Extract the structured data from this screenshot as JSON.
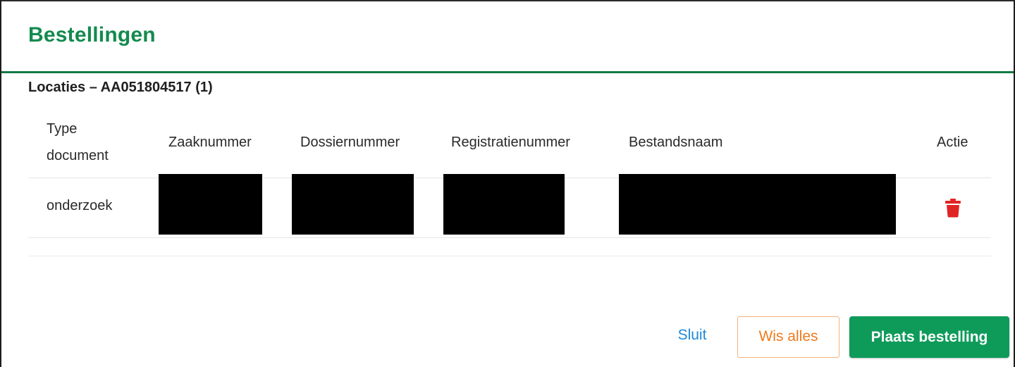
{
  "dialog": {
    "title": "Bestellingen",
    "section_title": "Locaties – AA051804517 (1)"
  },
  "table": {
    "headers": {
      "type_line1": "Type",
      "type_line2": "document",
      "zaaknummer": "Zaaknummer",
      "dossiernummer": "Dossiernummer",
      "registratienummer": "Registratienummer",
      "bestandsnaam": "Bestandsnaam",
      "actie": "Actie"
    },
    "rows": [
      {
        "type_document": "onderzoek",
        "action_icon": "trash-icon"
      }
    ]
  },
  "footer": {
    "close_label": "Sluit",
    "clear_label": "Wis alles",
    "submit_label": "Plaats bestelling"
  },
  "colors": {
    "brand_green": "#138a4e",
    "submit_green": "#0e9b5a",
    "link_blue": "#1a88d6",
    "clear_orange": "#ef7a1c",
    "delete_red": "#e02424"
  }
}
